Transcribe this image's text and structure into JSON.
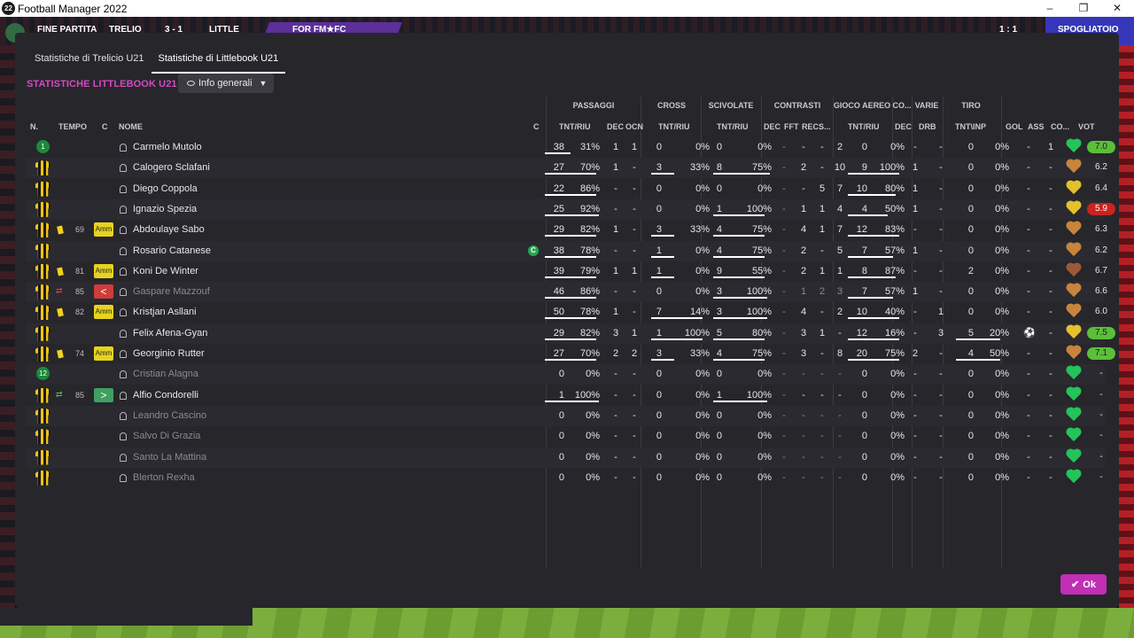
{
  "window": {
    "title": "Football Manager 2022",
    "app_icon": "22",
    "controls": [
      "–",
      "❐",
      "✕"
    ]
  },
  "background": {
    "items": [
      "FINE PARTITA",
      "TRELIO",
      "3 - 1",
      "LITTLE",
      "FOR FM★FC",
      "1 : 1",
      "SPOGLIATOIO"
    ]
  },
  "tabs": [
    {
      "label": "Statistiche di Trelicio U21",
      "active": false
    },
    {
      "label": "Statistiche di Littlebook U21",
      "active": true
    }
  ],
  "section_title": "STATISTICHE LITTLEBOOK U21",
  "view_dropdown": {
    "label": "Info generali",
    "icon": "eye-icon"
  },
  "groups": [
    "PASSAGGI",
    "CROSS",
    "SCIVOLATE",
    "CONTRASTI",
    "GIOCO AEREO",
    "CO...",
    "VARIE",
    "TIRO"
  ],
  "columns": {
    "n": "N.",
    "tempo": "TEMPO",
    "c": "C",
    "nome": "NOME",
    "cap": "C",
    "pass_tr": "TNT/RIU",
    "pass_dec": "DEC",
    "pass_ocn": "OCN",
    "cross_tr": "TNT/RIU",
    "sci_tr": "TNT/RIU",
    "con_dec": "DEC",
    "con_fft": "FFT",
    "con_rec": "REC",
    "con_s": "S...",
    "aer_tr": "TNT/RIU",
    "co_dec": "DEC",
    "var_drb": "DRB",
    "tiro_ti": "TNT\\INP",
    "gol": "GOL",
    "ass": "ASS",
    "co": "CO...",
    "vot": "VOT"
  },
  "players": [
    {
      "kit": "gk",
      "num": "1",
      "tempo": "",
      "card": "",
      "badge": "",
      "name": "Carmelo Mutolo",
      "dim": false,
      "captain": false,
      "pass": [
        "38",
        "31%"
      ],
      "pass_dec": "1",
      "pass_ocn": "1",
      "cross": [
        "0",
        "0%"
      ],
      "sci": [
        "0",
        "0%"
      ],
      "con": [
        "-",
        "-",
        "-",
        "2"
      ],
      "aer": [
        "0",
        "0%"
      ],
      "co_dec": "-",
      "drb": "-",
      "tiro": [
        "0",
        "0%"
      ],
      "gol": "-",
      "gol_icon": false,
      "ass": "1",
      "heart": "#23c45a",
      "vot": "7.0",
      "vot_bg": "#5bbf3a",
      "bars": [
        0.45,
        0,
        0,
        0,
        0
      ],
      "stripes_alt": false
    },
    {
      "kit": "kit",
      "num": "",
      "tempo": "",
      "card": "",
      "badge": "",
      "name": "Calogero Sclafani",
      "dim": false,
      "captain": false,
      "pass": [
        "27",
        "70%"
      ],
      "pass_dec": "1",
      "pass_ocn": "-",
      "cross": [
        "3",
        "33%"
      ],
      "sci": [
        "8",
        "75%"
      ],
      "con": [
        "-",
        "2",
        "-",
        "10"
      ],
      "aer": [
        "9",
        "100%"
      ],
      "co_dec": "1",
      "drb": "-",
      "tiro": [
        "0",
        "0%"
      ],
      "gol": "-",
      "gol_icon": false,
      "ass": "-",
      "heart": "#c8843c",
      "vot": "6.2",
      "vot_bg": "",
      "bars": [
        0.9,
        0.4,
        1.0,
        0,
        0.9
      ],
      "stripes_alt": true
    },
    {
      "kit": "kit",
      "num": "",
      "tempo": "",
      "card": "",
      "badge": "",
      "name": "Diego Coppola",
      "dim": false,
      "captain": false,
      "pass": [
        "22",
        "86%"
      ],
      "pass_dec": "-",
      "pass_ocn": "-",
      "cross": [
        "0",
        "0%"
      ],
      "sci": [
        "0",
        "0%"
      ],
      "con": [
        "-",
        "-",
        "5",
        "7"
      ],
      "aer": [
        "10",
        "80%"
      ],
      "co_dec": "1",
      "drb": "-",
      "tiro": [
        "0",
        "0%"
      ],
      "gol": "-",
      "gol_icon": false,
      "ass": "-",
      "heart": "#e3c12a",
      "vot": "6.4",
      "vot_bg": "",
      "bars": [
        0.9,
        0,
        0,
        0,
        0.85
      ],
      "stripes_alt": false
    },
    {
      "kit": "kit",
      "num": "",
      "tempo": "",
      "card": "",
      "badge": "",
      "name": "Ignazio Spezia",
      "dim": false,
      "captain": false,
      "pass": [
        "25",
        "92%"
      ],
      "pass_dec": "-",
      "pass_ocn": "-",
      "cross": [
        "0",
        "0%"
      ],
      "sci": [
        "1",
        "100%"
      ],
      "con": [
        "-",
        "1",
        "1",
        "4"
      ],
      "aer": [
        "4",
        "50%"
      ],
      "co_dec": "1",
      "drb": "-",
      "tiro": [
        "0",
        "0%"
      ],
      "gol": "-",
      "gol_icon": false,
      "ass": "-",
      "heart": "#e3c12a",
      "vot": "5.9",
      "vot_bg": "#c9241f",
      "bars": [
        0.95,
        0,
        0.9,
        0,
        0.7
      ],
      "stripes_alt": true
    },
    {
      "kit": "kit",
      "num": "",
      "tempo": "69",
      "card": "yellow",
      "badge": "Amm",
      "name": "Abdoulaye Sabo",
      "dim": false,
      "captain": false,
      "pass": [
        "29",
        "82%"
      ],
      "pass_dec": "1",
      "pass_ocn": "-",
      "cross": [
        "3",
        "33%"
      ],
      "sci": [
        "4",
        "75%"
      ],
      "con": [
        "-",
        "4",
        "1",
        "7"
      ],
      "aer": [
        "12",
        "83%"
      ],
      "co_dec": "-",
      "drb": "-",
      "tiro": [
        "0",
        "0%"
      ],
      "gol": "-",
      "gol_icon": false,
      "ass": "-",
      "heart": "#c8843c",
      "vot": "6.3",
      "vot_bg": "",
      "bars": [
        0.9,
        0.4,
        0.9,
        0,
        0.9
      ],
      "stripes_alt": false
    },
    {
      "kit": "kit",
      "num": "",
      "tempo": "",
      "card": "",
      "badge": "",
      "name": "Rosario Catanese",
      "dim": false,
      "captain": true,
      "pass": [
        "38",
        "78%"
      ],
      "pass_dec": "-",
      "pass_ocn": "-",
      "cross": [
        "1",
        "0%"
      ],
      "sci": [
        "4",
        "75%"
      ],
      "con": [
        "-",
        "2",
        "-",
        "5"
      ],
      "aer": [
        "7",
        "57%"
      ],
      "co_dec": "1",
      "drb": "-",
      "tiro": [
        "0",
        "0%"
      ],
      "gol": "-",
      "gol_icon": false,
      "ass": "-",
      "heart": "#c8843c",
      "vot": "6.2",
      "vot_bg": "",
      "bars": [
        0.9,
        0.4,
        0.9,
        0,
        0.8
      ],
      "stripes_alt": true
    },
    {
      "kit": "kit",
      "num": "",
      "tempo": "81",
      "card": "yellow",
      "badge": "Amm",
      "name": "Koni De Winter",
      "dim": false,
      "captain": false,
      "pass": [
        "39",
        "79%"
      ],
      "pass_dec": "1",
      "pass_ocn": "1",
      "cross": [
        "1",
        "0%"
      ],
      "sci": [
        "9",
        "55%"
      ],
      "con": [
        "-",
        "2",
        "1",
        "1"
      ],
      "aer": [
        "8",
        "87%"
      ],
      "co_dec": "-",
      "drb": "-",
      "tiro": [
        "2",
        "0%"
      ],
      "gol": "-",
      "gol_icon": false,
      "ass": "-",
      "heart": "#9a5a36",
      "vot": "6.7",
      "vot_bg": "",
      "bars": [
        0.9,
        0.4,
        0.9,
        0,
        0.85
      ],
      "stripes_alt": false
    },
    {
      "kit": "kit",
      "num": "",
      "tempo": "85",
      "card": "subout",
      "badge": "<",
      "name": "Gaspare Mazzouf",
      "dim": true,
      "captain": false,
      "pass": [
        "46",
        "86%"
      ],
      "pass_dec": "-",
      "pass_ocn": "-",
      "cross": [
        "0",
        "0%"
      ],
      "sci": [
        "3",
        "100%"
      ],
      "con": [
        "-",
        "1",
        "2",
        "3"
      ],
      "aer": [
        "7",
        "57%"
      ],
      "co_dec": "1",
      "drb": "-",
      "tiro": [
        "0",
        "0%"
      ],
      "gol": "-",
      "gol_icon": false,
      "ass": "-",
      "heart": "#c8843c",
      "vot": "6.6",
      "vot_bg": "",
      "bars": [
        0.9,
        0,
        0.95,
        0,
        0.8
      ],
      "stripes_alt": true
    },
    {
      "kit": "kit",
      "num": "",
      "tempo": "82",
      "card": "yellow",
      "badge": "Amm",
      "name": "Kristjan Asllani",
      "dim": false,
      "captain": false,
      "pass": [
        "50",
        "78%"
      ],
      "pass_dec": "1",
      "pass_ocn": "-",
      "cross": [
        "7",
        "14%"
      ],
      "sci": [
        "3",
        "100%"
      ],
      "con": [
        "-",
        "4",
        "-",
        "2"
      ],
      "aer": [
        "10",
        "40%"
      ],
      "co_dec": "-",
      "drb": "1",
      "tiro": [
        "0",
        "0%"
      ],
      "gol": "-",
      "gol_icon": false,
      "ass": "-",
      "heart": "#c8843c",
      "vot": "6.0",
      "vot_bg": "",
      "bars": [
        0.9,
        0.9,
        0.95,
        0,
        0.9
      ],
      "stripes_alt": false
    },
    {
      "kit": "kit",
      "num": "",
      "tempo": "",
      "card": "",
      "badge": "",
      "name": "Felix Afena-Gyan",
      "dim": false,
      "captain": false,
      "pass": [
        "29",
        "82%"
      ],
      "pass_dec": "3",
      "pass_ocn": "1",
      "cross": [
        "1",
        "100%"
      ],
      "sci": [
        "5",
        "80%"
      ],
      "con": [
        "-",
        "3",
        "1",
        "-"
      ],
      "aer": [
        "12",
        "16%"
      ],
      "co_dec": "-",
      "drb": "3",
      "tiro": [
        "5",
        "20%"
      ],
      "gol": "",
      "gol_icon": true,
      "ass": "-",
      "heart": "#e3c12a",
      "vot": "7.5",
      "vot_bg": "#5bbf3a",
      "bars": [
        0.9,
        0.9,
        0.9,
        0,
        0.9,
        0.9
      ],
      "stripes_alt": true
    },
    {
      "kit": "kit",
      "num": "",
      "tempo": "74",
      "card": "yellow",
      "badge": "Amm",
      "name": "Georginio Rutter",
      "dim": false,
      "captain": false,
      "pass": [
        "27",
        "70%"
      ],
      "pass_dec": "2",
      "pass_ocn": "2",
      "cross": [
        "3",
        "33%"
      ],
      "sci": [
        "4",
        "75%"
      ],
      "con": [
        "-",
        "3",
        "-",
        "8"
      ],
      "aer": [
        "20",
        "75%"
      ],
      "co_dec": "2",
      "drb": "-",
      "tiro": [
        "4",
        "50%"
      ],
      "gol": "-",
      "gol_icon": false,
      "ass": "-",
      "heart": "#c8843c",
      "vot": "7.1",
      "vot_bg": "#5bbf3a",
      "bars": [
        0.9,
        0.4,
        0.9,
        0,
        0.9,
        0.9
      ],
      "stripes_alt": false
    },
    {
      "kit": "gk",
      "num": "12",
      "tempo": "",
      "card": "",
      "badge": "",
      "name": "Cristian Alagna",
      "dim": true,
      "captain": false,
      "pass": [
        "0",
        "0%"
      ],
      "pass_dec": "-",
      "pass_ocn": "-",
      "cross": [
        "0",
        "0%"
      ],
      "sci": [
        "0",
        "0%"
      ],
      "con": [
        "-",
        "-",
        "-",
        "-"
      ],
      "aer": [
        "0",
        "0%"
      ],
      "co_dec": "-",
      "drb": "-",
      "tiro": [
        "0",
        "0%"
      ],
      "gol": "-",
      "gol_icon": false,
      "ass": "-",
      "heart": "#23c45a",
      "vot": "-",
      "vot_bg": "",
      "bars": [
        0,
        0,
        0,
        0,
        0
      ],
      "stripes_alt": true
    },
    {
      "kit": "kit",
      "num": "",
      "tempo": "85",
      "card": "subin",
      "badge": ">",
      "name": "Alfio Condorelli",
      "dim": false,
      "captain": false,
      "pass": [
        "1",
        "100%"
      ],
      "pass_dec": "-",
      "pass_ocn": "-",
      "cross": [
        "0",
        "0%"
      ],
      "sci": [
        "1",
        "100%"
      ],
      "con": [
        "-",
        "-",
        "-",
        "-"
      ],
      "aer": [
        "0",
        "0%"
      ],
      "co_dec": "-",
      "drb": "-",
      "tiro": [
        "0",
        "0%"
      ],
      "gol": "-",
      "gol_icon": false,
      "ass": "-",
      "heart": "#23c45a",
      "vot": "-",
      "vot_bg": "",
      "bars": [
        0.95,
        0,
        0.95,
        0,
        0
      ],
      "stripes_alt": false
    },
    {
      "kit": "kit",
      "num": "",
      "tempo": "",
      "card": "",
      "badge": "",
      "name": "Leandro Cascino",
      "dim": true,
      "captain": false,
      "pass": [
        "0",
        "0%"
      ],
      "pass_dec": "-",
      "pass_ocn": "-",
      "cross": [
        "0",
        "0%"
      ],
      "sci": [
        "0",
        "0%"
      ],
      "con": [
        "-",
        "-",
        "-",
        "-"
      ],
      "aer": [
        "0",
        "0%"
      ],
      "co_dec": "-",
      "drb": "-",
      "tiro": [
        "0",
        "0%"
      ],
      "gol": "-",
      "gol_icon": false,
      "ass": "-",
      "heart": "#23c45a",
      "vot": "-",
      "vot_bg": "",
      "bars": [
        0,
        0,
        0,
        0,
        0
      ],
      "stripes_alt": true
    },
    {
      "kit": "kit",
      "num": "",
      "tempo": "",
      "card": "",
      "badge": "",
      "name": "Salvo Di Grazia",
      "dim": true,
      "captain": false,
      "pass": [
        "0",
        "0%"
      ],
      "pass_dec": "-",
      "pass_ocn": "-",
      "cross": [
        "0",
        "0%"
      ],
      "sci": [
        "0",
        "0%"
      ],
      "con": [
        "-",
        "-",
        "-",
        "-"
      ],
      "aer": [
        "0",
        "0%"
      ],
      "co_dec": "-",
      "drb": "-",
      "tiro": [
        "0",
        "0%"
      ],
      "gol": "-",
      "gol_icon": false,
      "ass": "-",
      "heart": "#23c45a",
      "vot": "-",
      "vot_bg": "",
      "bars": [
        0,
        0,
        0,
        0,
        0
      ],
      "stripes_alt": false
    },
    {
      "kit": "kit",
      "num": "",
      "tempo": "",
      "card": "",
      "badge": "",
      "name": "Santo La Mattina",
      "dim": true,
      "captain": false,
      "pass": [
        "0",
        "0%"
      ],
      "pass_dec": "-",
      "pass_ocn": "-",
      "cross": [
        "0",
        "0%"
      ],
      "sci": [
        "0",
        "0%"
      ],
      "con": [
        "-",
        "-",
        "-",
        "-"
      ],
      "aer": [
        "0",
        "0%"
      ],
      "co_dec": "-",
      "drb": "-",
      "tiro": [
        "0",
        "0%"
      ],
      "gol": "-",
      "gol_icon": false,
      "ass": "-",
      "heart": "#23c45a",
      "vot": "-",
      "vot_bg": "",
      "bars": [
        0,
        0,
        0,
        0,
        0
      ],
      "stripes_alt": true
    },
    {
      "kit": "kit",
      "num": "",
      "tempo": "",
      "card": "",
      "badge": "",
      "name": "Blerton Rexha",
      "dim": true,
      "captain": false,
      "pass": [
        "0",
        "0%"
      ],
      "pass_dec": "-",
      "pass_ocn": "-",
      "cross": [
        "0",
        "0%"
      ],
      "sci": [
        "0",
        "0%"
      ],
      "con": [
        "-",
        "-",
        "-",
        "-"
      ],
      "aer": [
        "0",
        "0%"
      ],
      "co_dec": "-",
      "drb": "-",
      "tiro": [
        "0",
        "0%"
      ],
      "gol": "-",
      "gol_icon": false,
      "ass": "-",
      "heart": "#23c45a",
      "vot": "-",
      "vot_bg": "",
      "bars": [
        0,
        0,
        0,
        0,
        0
      ],
      "stripes_alt": false
    }
  ],
  "ok_button": {
    "label": "Ok",
    "icon": "check-icon"
  },
  "colors": {
    "accent": "#c22fb4",
    "title": "#d649c4",
    "good_vote": "#5bbf3a",
    "bad_vote": "#c9241f",
    "card": "#e7d31e"
  }
}
